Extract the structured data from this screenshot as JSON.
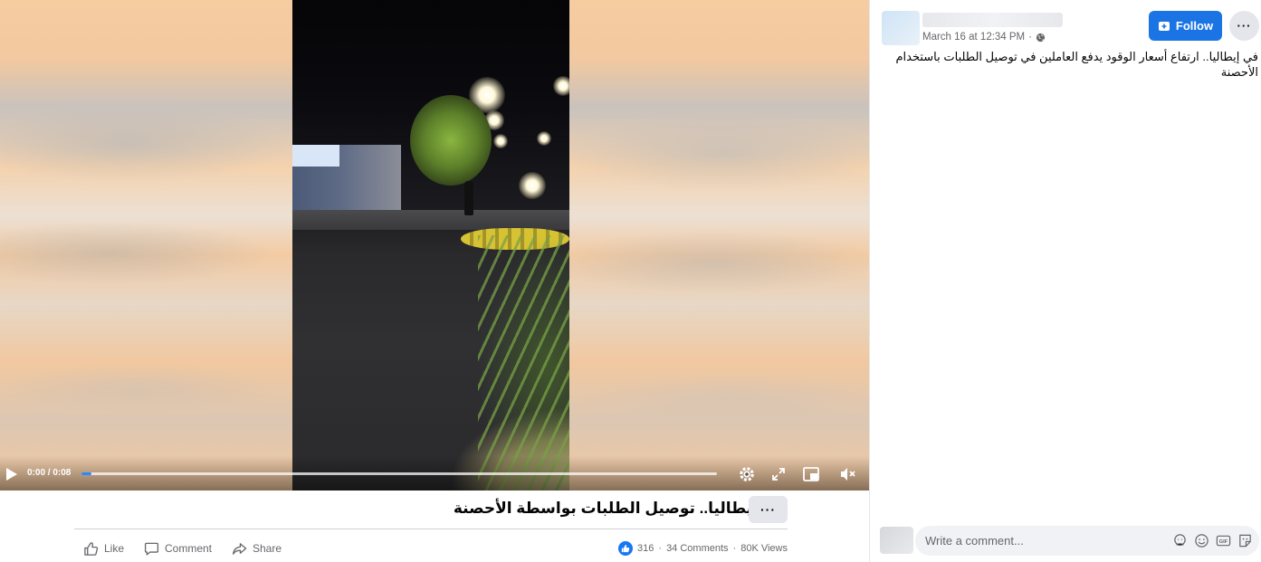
{
  "video": {
    "time": "0:00 / 0:08",
    "progress": 0.015,
    "caption": "في إيطاليا.. توصيل الطلبات بواسطة الأحصنة",
    "more_label": "···"
  },
  "actions": {
    "like": "Like",
    "comment": "Comment",
    "share": "Share"
  },
  "stats": {
    "reactions": "316",
    "separator": "·",
    "comments": "34 Comments",
    "views": "80K Views"
  },
  "post": {
    "timestamp": "March 16 at 12:34 PM",
    "meta_separator": "·",
    "audience_icon": "globe-icon",
    "follow_label": "Follow",
    "more_label": "···",
    "text": "في إيطاليا.. ارتفاع أسعار الوقود يدفع العاملين في توصيل الطلبات باستخدام الأحصنة"
  },
  "comment_composer": {
    "placeholder": "Write a comment...",
    "tools": [
      "avatar-sticker-icon",
      "emoji-icon",
      "gif-icon",
      "sticker-icon"
    ]
  },
  "colors": {
    "accent": "#1b74e4",
    "progress": "#2d88ff",
    "secondary_text": "#65676b"
  }
}
